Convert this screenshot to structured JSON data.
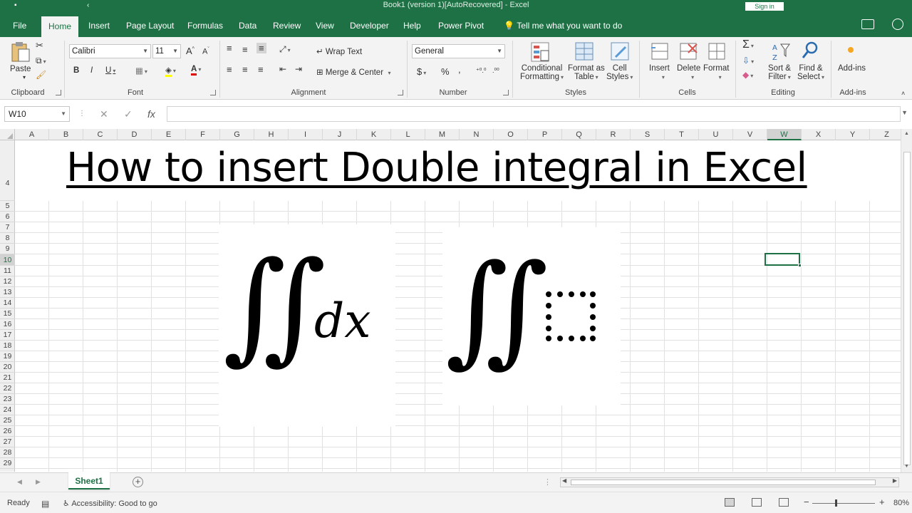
{
  "window": {
    "title": "Book1 (version 1)[AutoRecovered]  -  Excel",
    "sign_in": "Sign in"
  },
  "tabs": [
    "File",
    "Home",
    "Insert",
    "Page Layout",
    "Formulas",
    "Data",
    "Review",
    "View",
    "Developer",
    "Help",
    "Power Pivot"
  ],
  "active_tab": "Home",
  "tell_me": "Tell me what you want to do",
  "ribbon": {
    "clipboard": {
      "paste": "Paste",
      "label": "Clipboard"
    },
    "font": {
      "name": "Calibri",
      "size": "11",
      "bold": "B",
      "italic": "I",
      "underline": "U",
      "grow": "A",
      "shrink": "A",
      "label": "Font"
    },
    "alignment": {
      "wrap": "Wrap Text",
      "merge": "Merge & Center",
      "label": "Alignment"
    },
    "number": {
      "format": "General",
      "currency": "$",
      "percent": "%",
      "comma": ",",
      "label": "Number"
    },
    "styles": {
      "conditional_1": "Conditional",
      "conditional_2": "Formatting",
      "format_table_1": "Format as",
      "format_table_2": "Table",
      "cell_styles_1": "Cell",
      "cell_styles_2": "Styles",
      "label": "Styles"
    },
    "cells": {
      "insert": "Insert",
      "delete": "Delete",
      "format": "Format",
      "label": "Cells"
    },
    "editing": {
      "sort_1": "Sort &",
      "sort_2": "Filter",
      "find_1": "Find &",
      "find_2": "Select",
      "label": "Editing"
    },
    "addins": {
      "button": "Add-ins",
      "label": "Add-ins"
    }
  },
  "formula_bar": {
    "name_box": "W10",
    "cancel": "✕",
    "enter": "✓",
    "fx": "fx",
    "value": ""
  },
  "columns": [
    "A",
    "B",
    "C",
    "D",
    "E",
    "F",
    "G",
    "H",
    "I",
    "J",
    "K",
    "L",
    "M",
    "N",
    "O",
    "P",
    "Q",
    "R",
    "S",
    "T",
    "U",
    "V",
    "W",
    "X",
    "Y",
    "Z"
  ],
  "rows": [
    "4",
    "5",
    "6",
    "7",
    "8",
    "9",
    "10",
    "11",
    "12",
    "13",
    "14",
    "15",
    "16",
    "17",
    "18",
    "19",
    "20",
    "21",
    "22",
    "23",
    "24",
    "25",
    "26",
    "27",
    "28",
    "29"
  ],
  "selected_cell": {
    "column": "W",
    "row": "10"
  },
  "sheet": {
    "heading": "How to insert Double integral in Excel",
    "equation_1": {
      "integral": "∬",
      "variable": "dx"
    },
    "equation_2": {
      "integral": "∬",
      "placeholder": "placeholder-box"
    }
  },
  "sheet_tabs": [
    "Sheet1"
  ],
  "status": {
    "ready": "Ready",
    "accessibility": "Accessibility: Good to go",
    "zoom": "80%",
    "minus": "−",
    "plus": "+"
  },
  "colors": {
    "accent": "#1e7145",
    "ribbon_bg": "#f3f3f3",
    "grid_line": "#e1e1e1"
  }
}
